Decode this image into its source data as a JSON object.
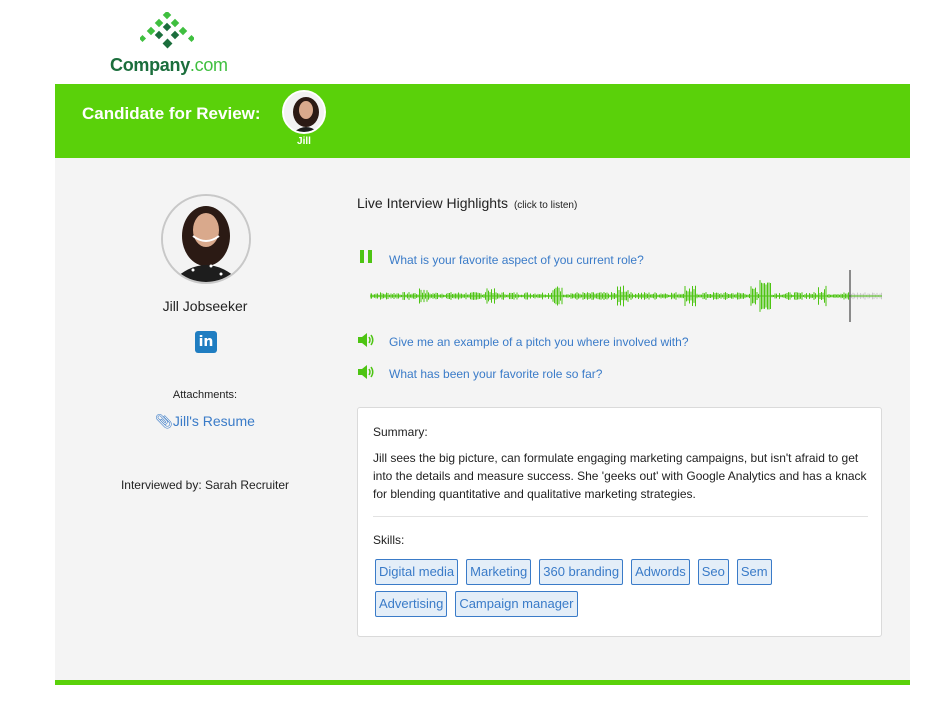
{
  "brand": {
    "name_main": "Company",
    "name_suffix": ".com"
  },
  "header": {
    "title": "Candidate for Review:",
    "candidate_short": "Jill"
  },
  "candidate": {
    "full_name": "Jill Jobseeker",
    "attachments_label": "Attachments:",
    "resume_link": "Jill's Resume",
    "interviewed_by": "Interviewed by: Sarah Recruiter"
  },
  "highlights": {
    "title": "Live Interview Highlights",
    "hint": "(click to listen)",
    "questions": [
      {
        "text": "What is your favorite aspect of you current role?",
        "state": "playing",
        "icon": "pause-icon"
      },
      {
        "text": "Give me an example of a pitch you where involved with?",
        "state": "idle",
        "icon": "speaker-icon"
      },
      {
        "text": "What has been your favorite role so far?",
        "state": "idle",
        "icon": "speaker-icon"
      }
    ]
  },
  "summary": {
    "label": "Summary:",
    "text": "Jill sees the big picture, can formulate engaging marketing campaigns, but isn't afraid to get into the details and measure success. She 'geeks out' with Google Analytics and has a knack for blending quantitative and qualitative marketing strategies.",
    "skills_label": "Skills:",
    "skills": [
      "Digital media",
      "Marketing",
      "360 branding",
      "Adwords",
      "Seo",
      "Sem",
      "Advertising",
      "Campaign manager"
    ]
  },
  "colors": {
    "accent_green": "#5ad10a",
    "link_blue": "#3a7bc8",
    "linkedin_blue": "#1f7dc1"
  }
}
